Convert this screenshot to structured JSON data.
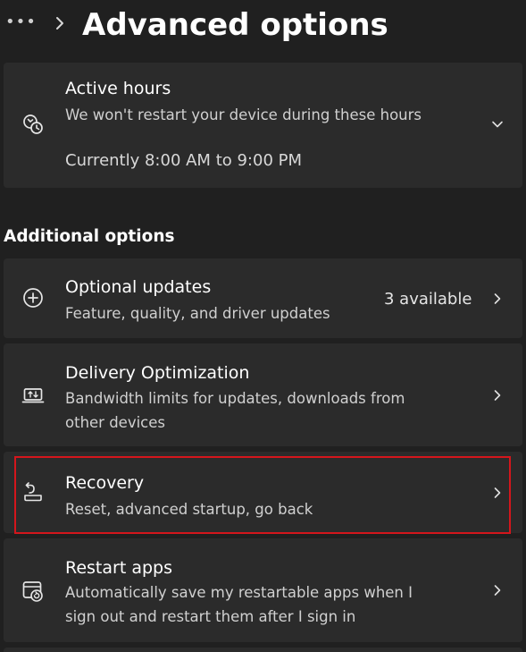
{
  "header": {
    "more_label": "•••",
    "title": "Advanced options"
  },
  "active_hours": {
    "title": "Active hours",
    "description": "We won't restart your device during these hours",
    "current": "Currently 8:00 AM to 9:00 PM",
    "icon": "active-hours-icon"
  },
  "additional": {
    "header": "Additional options",
    "items": [
      {
        "title": "Optional updates",
        "subtitle_lines": [
          "Feature, quality, and driver updates"
        ],
        "value": "3 available",
        "icon": "add-circle-icon"
      },
      {
        "title": "Delivery Optimization",
        "subtitle_lines": [
          "Bandwidth limits for updates, downloads from",
          "other devices"
        ],
        "icon": "delivery-optimization-icon"
      },
      {
        "title": "Recovery",
        "subtitle_lines": [
          "Reset, advanced startup, go back"
        ],
        "icon": "recovery-icon",
        "highlighted": true
      },
      {
        "title": "Restart apps",
        "subtitle_lines": [
          "Automatically save my restartable apps when I",
          "sign out and restart them after I sign in"
        ],
        "icon": "restart-apps-icon"
      }
    ]
  },
  "colors": {
    "background": "#202020",
    "card": "#2b2b2b",
    "text_primary": "#ffffff",
    "text_secondary": "#d0d0d0",
    "highlight": "#d4161c"
  }
}
